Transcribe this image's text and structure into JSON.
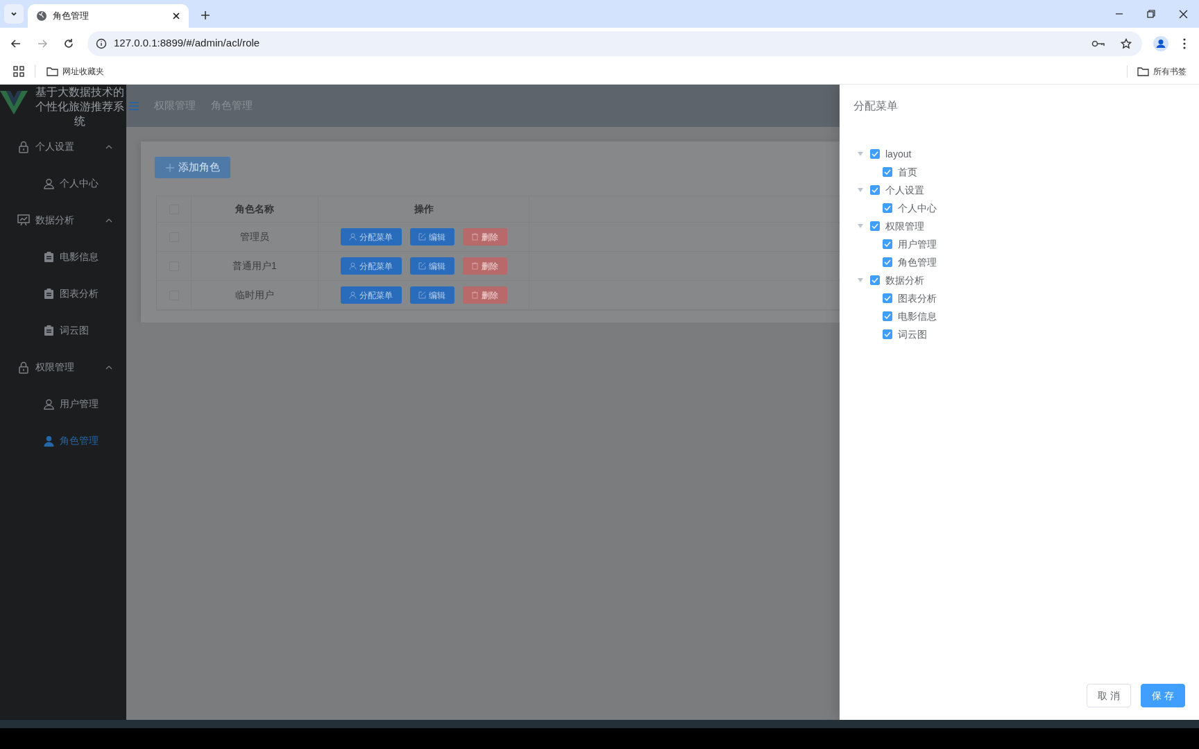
{
  "browser": {
    "tabs": [
      {
        "title": "角色管理",
        "selected": true
      }
    ],
    "url": "127.0.0.1:8899/#/admin/acl/role",
    "bookmarks": [
      {
        "label": "网址收藏夹"
      }
    ],
    "all_bookmarks": "所有书签"
  },
  "app": {
    "title": "基于大数据技术的个性化旅游推荐系统",
    "sidebar": [
      {
        "label": "个人设置",
        "expanded": true,
        "children": [
          {
            "label": "个人中心",
            "selected": false
          }
        ]
      },
      {
        "label": "数据分析",
        "expanded": true,
        "children": [
          {
            "label": "电影信息",
            "selected": false
          },
          {
            "label": "图表分析",
            "selected": false
          },
          {
            "label": "词云图",
            "selected": false
          }
        ]
      },
      {
        "label": "权限管理",
        "expanded": true,
        "children": [
          {
            "label": "用户管理",
            "selected": false
          },
          {
            "label": "角色管理",
            "selected": true
          }
        ]
      }
    ],
    "breadcrumb": [
      "权限管理",
      "角色管理"
    ],
    "add_button": "添加角色",
    "table": {
      "select_all_checked": false,
      "columns": [
        "角色名称",
        "操作"
      ],
      "rows": [
        {
          "name": "管理员",
          "checked": false,
          "actions": [
            "分配菜单",
            "编辑",
            "删除"
          ]
        },
        {
          "name": "普通用户1",
          "checked": false,
          "actions": [
            "分配菜单",
            "编辑",
            "删除"
          ]
        },
        {
          "name": "临时用户",
          "checked": false,
          "actions": [
            "分配菜单",
            "编辑",
            "删除"
          ]
        }
      ]
    }
  },
  "drawer": {
    "title": "分配菜单",
    "tree": [
      {
        "label": "layout",
        "checked": true,
        "expanded": true,
        "children": [
          {
            "label": "首页",
            "checked": true
          }
        ]
      },
      {
        "label": "个人设置",
        "checked": true,
        "expanded": true,
        "children": [
          {
            "label": "个人中心",
            "checked": true
          }
        ]
      },
      {
        "label": "权限管理",
        "checked": true,
        "expanded": true,
        "children": [
          {
            "label": "用户管理",
            "checked": true
          },
          {
            "label": "角色管理",
            "checked": true
          }
        ]
      },
      {
        "label": "数据分析",
        "checked": true,
        "expanded": true,
        "children": [
          {
            "label": "图表分析",
            "checked": true
          },
          {
            "label": "电影信息",
            "checked": true
          },
          {
            "label": "词云图",
            "checked": true
          }
        ]
      }
    ],
    "buttons": [
      {
        "label": "取 消",
        "kind": "secondary"
      },
      {
        "label": "保 存",
        "kind": "primary"
      }
    ]
  }
}
